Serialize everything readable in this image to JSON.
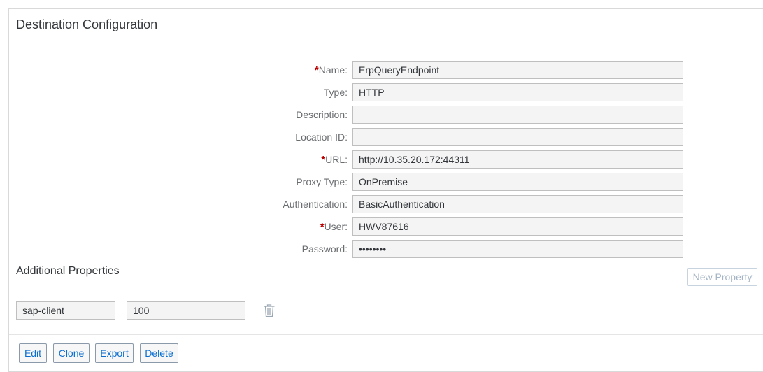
{
  "header": {
    "title": "Destination Configuration"
  },
  "form": {
    "fields": [
      {
        "label": "Name:",
        "required": true,
        "value": "ErpQueryEndpoint"
      },
      {
        "label": "Type:",
        "required": false,
        "value": "HTTP"
      },
      {
        "label": "Description:",
        "required": false,
        "value": ""
      },
      {
        "label": "Location ID:",
        "required": false,
        "value": ""
      },
      {
        "label": "URL:",
        "required": true,
        "value": "http://10.35.20.172:44311"
      },
      {
        "label": "Proxy Type:",
        "required": false,
        "value": "OnPremise"
      },
      {
        "label": "Authentication:",
        "required": false,
        "value": "BasicAuthentication"
      },
      {
        "label": "User:",
        "required": true,
        "value": "HWV87616"
      },
      {
        "label": "Password:",
        "required": false,
        "value": "••••••••"
      }
    ],
    "required_marker": "*"
  },
  "additional_properties": {
    "title": "Additional Properties",
    "new_property_label": "New Property",
    "rows": [
      {
        "key": "sap-client",
        "value": "100"
      }
    ],
    "delete_icon": "trash-icon"
  },
  "footer": {
    "buttons": [
      "Edit",
      "Clone",
      "Export",
      "Delete"
    ]
  },
  "colors": {
    "required": "#bb0000",
    "button_text": "#0a6ed1",
    "disabled_text": "#a4b4c4"
  }
}
